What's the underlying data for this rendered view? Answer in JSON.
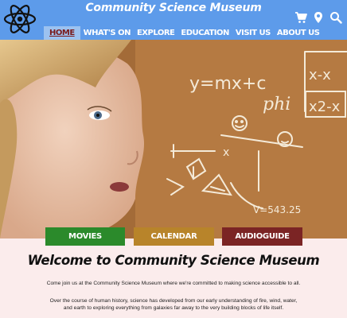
{
  "header": {
    "title": "Community Science Museum",
    "nav": [
      {
        "label": "HOME",
        "active": true
      },
      {
        "label": "WHAT'S ON"
      },
      {
        "label": "EXPLORE"
      },
      {
        "label": "EDUCATION"
      },
      {
        "label": "VISIT US"
      },
      {
        "label": "ABOUT US"
      }
    ],
    "icons": [
      "cart-icon",
      "location-pin-icon",
      "search-icon"
    ]
  },
  "hero": {
    "chalk_text": [
      "y=mx+c",
      "phi",
      "x-x",
      "x2-x",
      "V=543.25",
      "x"
    ]
  },
  "buttons": {
    "movies": "MOVIES",
    "calendar": "CALENDAR",
    "audioguide": "AUDIOGUIDE"
  },
  "main": {
    "welcome": "Welcome to Community Science Museum",
    "p1": "Come join us at the Community Science Museum where we're committed to making science accessible to all.",
    "p2": "Over the course of human history, science has developed from our early understanding of fire, wind, water, and earth to exploring everything from galaxies far away to the very building blocks of life itself."
  },
  "colors": {
    "header": "#5d9bea",
    "movies": "#2b8a2b",
    "calendar": "#b8842a",
    "audioguide": "#7b2424",
    "page_bg": "#fbecec"
  }
}
